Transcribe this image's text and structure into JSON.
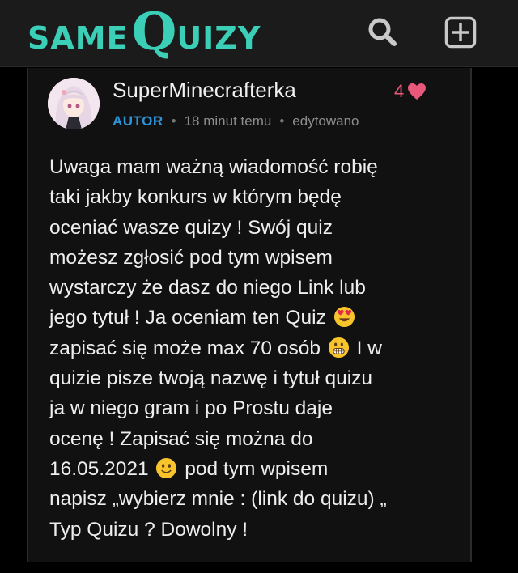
{
  "header": {
    "logo_same": "SAME",
    "logo_q": "Q",
    "logo_uizy": "UIZY",
    "icons": [
      "search-icon",
      "add-square-icon"
    ],
    "accent": "#3ccfb8"
  },
  "comment": {
    "username": "SuperMinecrafterka",
    "likes": "4",
    "role": "AUTOR",
    "time": "18 minut temu",
    "edited": "edytowano",
    "lines": [
      "Uwaga mam ważną wiadomość robię",
      "taki jakby konkurs w którym będę",
      "oceniać wasze quizy ! Swój quiz",
      "możesz zgłosić pod tym wpisem",
      "wystarczy że dasz do niego Link lub",
      "jego tytuł ! Ja oceniam ten Quiz",
      "zapisać się może max 70 osób",
      "I w",
      "quizie pisze twoją nazwę i tytuł quizu",
      "ja w niego gram i po Prostu daje",
      "ocenę ! Zapisać się można do",
      "16.05.2021",
      "pod tym wpisem",
      "napisz „wybierz mnie : (link do quizu) „",
      "Typ Quizu ? Dowolny !"
    ],
    "emojis": [
      "heart-eyes-emoji",
      "grimacing-emoji",
      "slightly-smiling-emoji"
    ],
    "colors": {
      "like": "#e8587a",
      "role": "#2f93d8"
    }
  }
}
